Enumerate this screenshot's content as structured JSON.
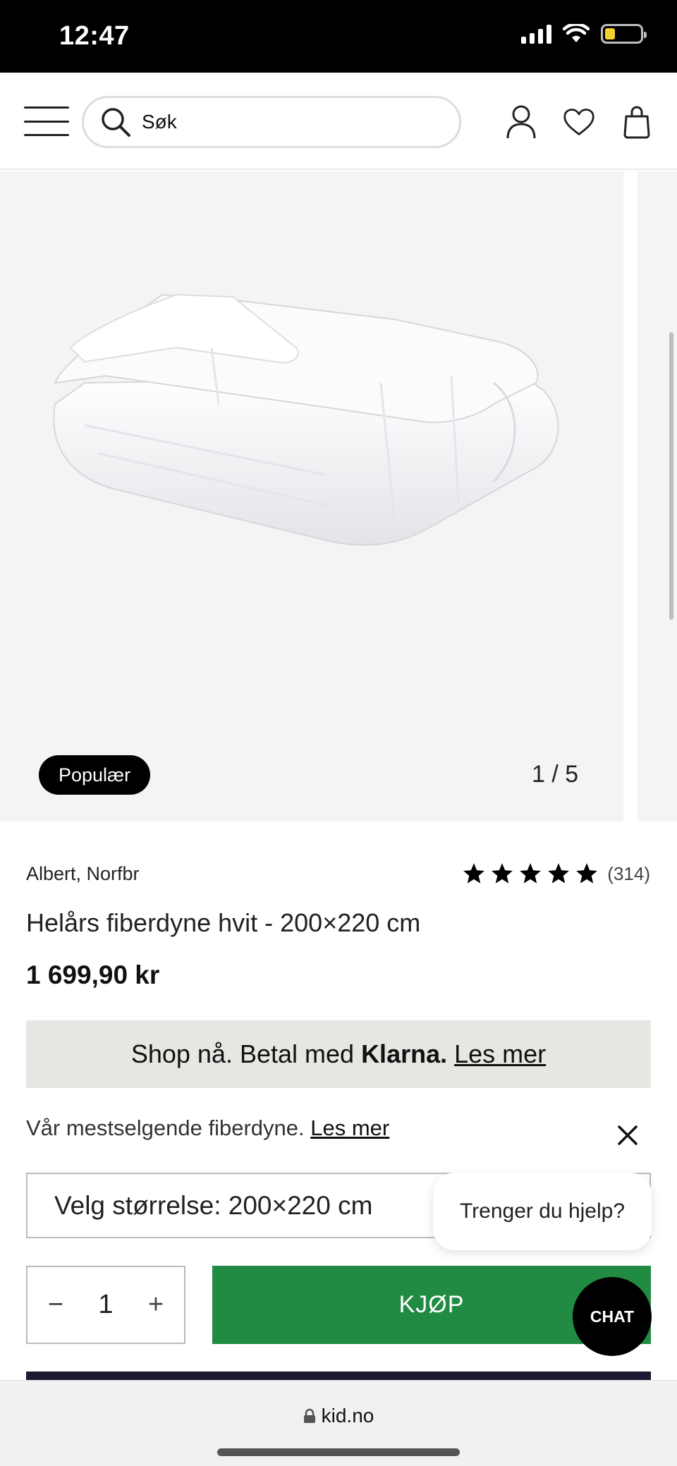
{
  "status_bar": {
    "time": "12:47"
  },
  "header": {
    "search_placeholder": "Søk"
  },
  "gallery": {
    "badge": "Populær",
    "counter": "1 / 5"
  },
  "product": {
    "brand": "Albert, Norfbr",
    "rating_count": "(314)",
    "stars": 5,
    "title": "Helårs fiberdyne hvit - 200×220 cm",
    "price": "1 699,90 kr"
  },
  "klarna": {
    "prefix": "Shop nå. Betal med",
    "brand": "Klarna.",
    "link": "Les mer"
  },
  "description": {
    "text": "Vår mestselgende fiberdyne.",
    "link": "Les mer"
  },
  "size_select": {
    "label": "Velg størrelse: 200×220 cm"
  },
  "help": {
    "bubble_text": "Trenger du hjelp?",
    "chat_label": "CHAT"
  },
  "purchase": {
    "quantity": "1",
    "minus": "−",
    "plus": "+",
    "buy_label": "KJØP"
  },
  "browser": {
    "url": "kid.no"
  },
  "colors": {
    "buy_green": "#228b43",
    "klarna_bg": "#e7e6e3",
    "battery_yellow": "#f4d22e"
  }
}
